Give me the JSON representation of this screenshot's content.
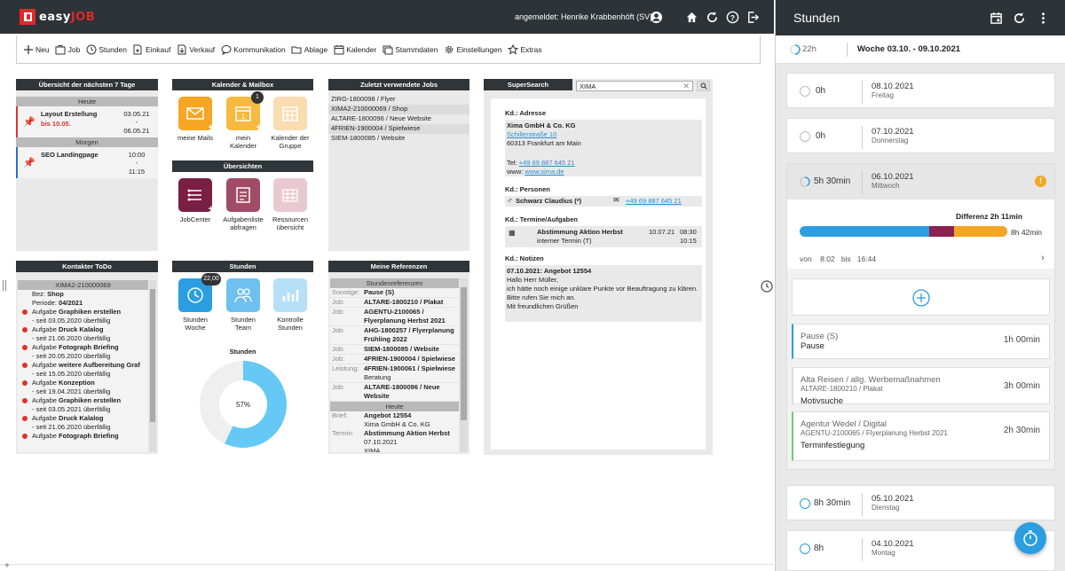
{
  "header": {
    "logo_prefix": "easy",
    "logo_suffix": "JOB",
    "user": "angemeldet: Henrike Krabbenhöft (SV)"
  },
  "toolbar": {
    "items": [
      "Neu",
      "Job",
      "Stunden",
      "Einkauf",
      "Verkauf",
      "Kommunikation",
      "Ablage",
      "Kalender",
      "Stammdaten",
      "Einstellungen",
      "Extras"
    ]
  },
  "overview": {
    "title": "Übersicht der nächsten 7 Tage",
    "today_label": "Heute",
    "tomorrow_label": "Morgen",
    "today_item": {
      "title": "Layout Erstellung",
      "due": "bis 10.05.",
      "start": "03.05.21",
      "dash": "-",
      "end": "06.05.21"
    },
    "tomorrow_item": {
      "title": "SEO Landingpage",
      "start": "10:00",
      "dash": "-",
      "end": "11:15"
    }
  },
  "calendar": {
    "title": "Kalender & Mailbox",
    "mails": "meine Mails",
    "my_calendar": "mein Kalender",
    "group_calendar": "Kalender der Gruppe",
    "badge": "1"
  },
  "overviews": {
    "title": "Übersichten",
    "jobcenter": "JobCenter",
    "tasks": "Aufgabenliste abfragen",
    "resources": "Ressourcen übersicht"
  },
  "recent": {
    "title": "Zuletzt verwendete Jobs",
    "items": [
      "ZIRG-1800098 / Flyer",
      "XIMA2-210000069 / Shop",
      "ALTARE-1800096 / Neue Website",
      "4FRIEN-1900004 / Spielwiese",
      "SIEM-1800085 / Website"
    ]
  },
  "search": {
    "title": "SuperSearch",
    "value": "XIMA",
    "address_label": "Kd.: Adresse",
    "company": "Xima GmbH & Co. KG",
    "street": "Schillerstraße 10",
    "city": "60313 Frankfurt am Main",
    "tel": "Tel: ",
    "tel_value": "+49 69 887 645 21",
    "www": "www: ",
    "www_value": "www.xima.de",
    "persons_label": "Kd.: Personen",
    "person": "Schwarz Claudius (*)",
    "person_tel": "+49 69 887 645 21",
    "dates_label": "Kd.: Termine/Aufgaben",
    "appt": "Abstimmung Aktion Herbst",
    "appt_sub": "interner Termin (T)",
    "appt_date": "10.07.21",
    "appt_from": "08:30",
    "appt_to": "10:15",
    "notes_label": "Kd.: Notizen",
    "note_title": "07.10.2021: Angebot 12554",
    "note_lines": [
      "Hallo Herr Müller,",
      "ich hätte noch einige unklare Punkte vor Beauftragung zu klären.",
      "Bitte rufen Sie mich an.",
      "Mit freundlichen Grüßen"
    ]
  },
  "contacts": {
    "title": "Kontakter ToDo",
    "job": "XIMA2-210000069",
    "bez_label": "Bez: ",
    "bez": "Shop",
    "period_label": "Periode: ",
    "period": "04/2021",
    "tasks": [
      {
        "pre": "Aufgabe ",
        "name": "Graphiken erstellen",
        "sub": "- seit 03.05.2020 überfällig"
      },
      {
        "pre": "Aufgabe ",
        "name": "Druck Kalalog",
        "sub": "- seit 21.06.2020 überfällig"
      },
      {
        "pre": "Aufgabe ",
        "name": "Fotograph Briefing",
        "sub": "- seit 20.05.2020 überfällig"
      },
      {
        "pre": "Aufgabe ",
        "name": "weitere Aufbereitung Graf",
        "sub": "- seit 15.05.2020 überfällig"
      },
      {
        "pre": "Aufgabe ",
        "name": "Konzeption",
        "sub": "- seit 19.04.2021 überfällig"
      },
      {
        "pre": "Aufgabe ",
        "name": "Graphiken erstellen",
        "sub": "- seit 03.05.2021 überfällig"
      },
      {
        "pre": "Aufgabe ",
        "name": "Druck Kalalog",
        "sub": "- seit 21.06.2020 überfällig"
      },
      {
        "pre": "Aufgabe ",
        "name": "Fotograph Briefing",
        "sub": ""
      }
    ]
  },
  "hours": {
    "title": "Stunden",
    "week": "Stunden Woche",
    "team": "Stunden Team",
    "control": "Kontrolle Stunden",
    "badge": "22,00",
    "chart_title": "Stunden",
    "percent": "57%",
    "fraction": 0.57
  },
  "refs": {
    "title": "Meine Referenzen",
    "sub": "Stundenreferenzen",
    "today": "Heute",
    "rows": [
      [
        "Sonstige:",
        "Pause (S)"
      ],
      [
        "Job:",
        "ALTARE-1800210 / Plakat"
      ],
      [
        "Job:",
        "AGENTU-2100065 / Flyerplanung Herbst 2021"
      ],
      [
        "Job:",
        "AHG-1800257 / Flyerplanung Frühling 2022"
      ],
      [
        "Job:",
        "SIEM-1800085 / Website"
      ],
      [
        "Job:",
        "4FRIEN-1900004 / Spielwiese"
      ],
      [
        "Leistung:",
        "4FRIEN-1900061 / Spielwiese",
        "Beratung"
      ],
      [
        "Job:",
        "ALTARE-1800096 / Neue Website"
      ]
    ],
    "today_rows": [
      [
        "Brief:",
        "Angebot 12554",
        "Xima GmbH & Co. KG"
      ],
      [
        "Termin:",
        "Abstimmung Aktion Herbst",
        "07.10.2021",
        "XIMA"
      ]
    ]
  },
  "right": {
    "title": "Stunden",
    "week_hours": "22h",
    "week_label": "Woche 03.10. - 09.10.2021",
    "days": [
      {
        "hrs": "0h",
        "date": "08.10.2021",
        "wd": "Freitag"
      },
      {
        "hrs": "0h",
        "date": "07.10.2021",
        "wd": "Donnerstag"
      },
      {
        "hrs": "5h 30min",
        "date": "06.10.2021",
        "wd": "Mittwoch"
      },
      {
        "hrs": "8h 30min",
        "date": "05.10.2021",
        "wd": "Dienstag"
      },
      {
        "hrs": "8h",
        "date": "04.10.2021",
        "wd": "Montag"
      }
    ],
    "diff": "Differenz 2h 11min",
    "total": "8h 42min",
    "from_label": "von",
    "from": "8:02",
    "to_label": "bis",
    "to": "16:44",
    "entries": [
      {
        "t1": "Pause (S)",
        "t2": "",
        "t3": "Pause",
        "dur": "1h 00min",
        "color": "#2a9ee0"
      },
      {
        "t1": "Alta Reisen / allg. Werbemaßnahmen",
        "t2": "ALTARE-1800210 / Plakat",
        "t3": "Motivsuche",
        "dur": "3h 00min",
        "color": "#dddddd"
      },
      {
        "t1": "Agentur Wedel / Digital",
        "t2": "AGENTU-2100065 / Flyerplanung Herbst 2021",
        "t3": "Terminfestlegung",
        "dur": "2h 30min",
        "color": "#7cc47c"
      }
    ]
  },
  "colors": {
    "accent": "#2a9ee0",
    "orange": "#f5a623",
    "purple": "#8b2250",
    "mail": "#f5a623",
    "calendar": "#f7b93f",
    "group": "#f9dcb0",
    "jobcenter": "#7a1f44",
    "tasks": "#a14b64",
    "resources": "#e8c9d2",
    "week": "#2a9ee0",
    "team": "#6ec1ee",
    "control": "#b6e0f7"
  }
}
